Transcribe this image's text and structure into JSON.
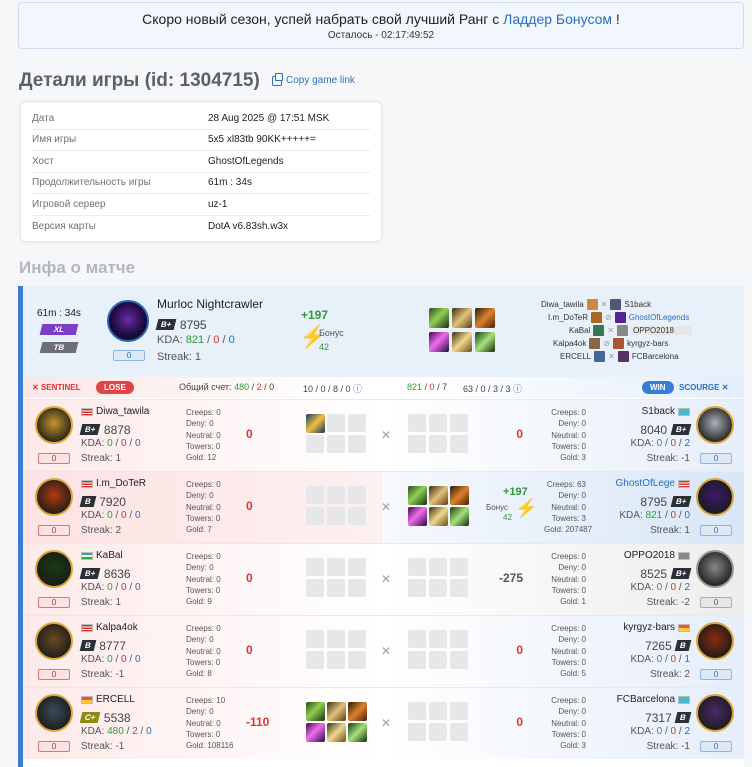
{
  "banner": {
    "text": "Скоро новый сезон, успей набрать свой лучший Ранг с",
    "link": "Ладдер Бонусом",
    "suffix": " !",
    "timer": "Осталось - 02:17:49:52"
  },
  "page": {
    "title": "Детали игры (id: 1304715)",
    "copy_link": "Copy game link",
    "section": "Инфа о матче"
  },
  "details": [
    {
      "label": "Дата",
      "value": "28 Aug 2025 @ 17:51 MSK"
    },
    {
      "label": "Имя игры",
      "value": "5x5 xl83tb 90KK+++++="
    },
    {
      "label": "Хост",
      "value": "GhostOfLegends"
    },
    {
      "label": "Продолжительность игры",
      "value": "61m : 34s"
    },
    {
      "label": "Игровой сервер",
      "value": "uz-1"
    },
    {
      "label": "Версия карты",
      "value": "DotA v6.83sh.w3x"
    }
  ],
  "summary": {
    "duration": "61m : 34s",
    "mode1": "XL",
    "mode2": "TB",
    "hero_level": "0",
    "player": "Murloc Nightcrawler",
    "rank": "B+",
    "rating": "8795",
    "kda_label": "KDA:",
    "k": "821",
    "d": "0",
    "a": "0",
    "sep": "/",
    "streak": "Streak: 1",
    "delta": "+197",
    "bonus_label": "Бонус",
    "bonus": "42",
    "pairs": [
      {
        "l": "Diwa_tawila",
        "r": "S1back"
      },
      {
        "l": "I.m_DoTeR",
        "r": "GhostOfLegends"
      },
      {
        "l": "KaBal",
        "r": "OPPO2018"
      },
      {
        "l": "Kalpa4ok",
        "r": "kyrgyz-bars"
      },
      {
        "l": "ERCELL",
        "r": "FCBarcelona"
      }
    ]
  },
  "teams": {
    "sentinel": "SENTINEL",
    "lose": "LOSE",
    "win": "WIN",
    "scourge": "SCOURGE",
    "score_label": "Общий счет:",
    "s1": "480",
    "s2": "2",
    "s3": "0",
    "mid1": "10 / 0 / 8 / 0",
    "r1": "821",
    "r2": "0",
    "r3": "7",
    "mid2": "63 / 0 / 3 / 3"
  },
  "labels": {
    "creeps": "Creeps:",
    "deny": "Deny:",
    "neutral": "Neutral:",
    "towers": "Towers:",
    "gold": "Gold:",
    "kda": "KDA:",
    "bonus": "Бонус"
  },
  "rows": [
    {
      "left": {
        "name": "Diwa_tawila",
        "rank": "B+",
        "rating": "8878",
        "k": "0",
        "d": "0",
        "a": "0",
        "streak": "Streak: 1",
        "lvl": "0",
        "creeps": "0",
        "deny": "0",
        "neutral": "0",
        "towers": "0",
        "gold": "12",
        "num": "0"
      },
      "right": {
        "name": "S1back",
        "rank": "B+",
        "rating": "8040",
        "k": "0",
        "d": "0",
        "a": "2",
        "streak": "Streak: -1",
        "lvl": "0",
        "creeps": "0",
        "deny": "0",
        "neutral": "0",
        "towers": "0",
        "gold": "3",
        "num": "0"
      }
    },
    {
      "left": {
        "name": "I.m_DoTeR",
        "rank": "B",
        "rating": "7920",
        "k": "0",
        "d": "0",
        "a": "0",
        "streak": "Streak: 2",
        "lvl": "0",
        "creeps": "0",
        "deny": "0",
        "neutral": "0",
        "towers": "0",
        "gold": "7",
        "num": "0"
      },
      "right": {
        "name": "GhostOfLege",
        "rank": "B+",
        "rating": "8795",
        "k": "821",
        "d": "0",
        "a": "0",
        "streak": "Streak: 1",
        "lvl": "0",
        "creeps": "63",
        "deny": "0",
        "neutral": "0",
        "towers": "3",
        "gold": "207487",
        "delta": "+197",
        "bonus": "42"
      }
    },
    {
      "left": {
        "name": "KaBal",
        "rank": "B+",
        "rating": "8636",
        "k": "0",
        "d": "0",
        "a": "0",
        "streak": "Streak: 1",
        "lvl": "0",
        "creeps": "0",
        "deny": "0",
        "neutral": "0",
        "towers": "0",
        "gold": "9",
        "num": "0"
      },
      "right": {
        "name": "OPPO2018",
        "rank": "B+",
        "rating": "8525",
        "k": "0",
        "d": "0",
        "a": "2",
        "streak": "Streak: -2",
        "lvl": "0",
        "creeps": "0",
        "deny": "0",
        "neutral": "0",
        "towers": "0",
        "gold": "1",
        "num": "-275"
      }
    },
    {
      "left": {
        "name": "Kalpa4ok",
        "rank": "B",
        "rating": "8777",
        "k": "0",
        "d": "0",
        "a": "0",
        "streak": "Streak: -1",
        "lvl": "0",
        "creeps": "0",
        "deny": "0",
        "neutral": "0",
        "towers": "0",
        "gold": "8",
        "num": "0"
      },
      "right": {
        "name": "kyrgyz-bars",
        "rank": "B",
        "rating": "7265",
        "k": "0",
        "d": "0",
        "a": "1",
        "streak": "Streak: 2",
        "lvl": "0",
        "creeps": "0",
        "deny": "0",
        "neutral": "0",
        "towers": "0",
        "gold": "5",
        "num": "0"
      }
    },
    {
      "left": {
        "name": "ERCELL",
        "rank": "C+",
        "rating": "5538",
        "k": "480",
        "d": "2",
        "a": "0",
        "streak": "Streak: -1",
        "lvl": "0",
        "creeps": "10",
        "deny": "0",
        "neutral": "0",
        "towers": "0",
        "gold": "108116",
        "num": "-110"
      },
      "right": {
        "name": "FCBarcelona",
        "rank": "B",
        "rating": "7317",
        "k": "0",
        "d": "0",
        "a": "2",
        "streak": "Streak: -1",
        "lvl": "0",
        "creeps": "0",
        "deny": "0",
        "neutral": "0",
        "towers": "0",
        "gold": "3",
        "num": "0"
      }
    }
  ]
}
